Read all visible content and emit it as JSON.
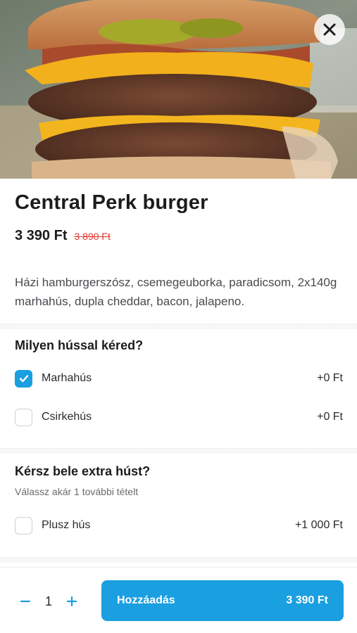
{
  "product": {
    "name": "Central Perk burger",
    "price": "3 390 Ft",
    "old_price": "3 890 Ft",
    "description": "Házi hamburgerszósz, csemegeuborka, paradicsom, 2x140g marhahús, dupla cheddar, bacon, jalapeno."
  },
  "meat_section": {
    "title": "Milyen hússal kéred?",
    "options": [
      {
        "label": "Marhahús",
        "price": "+0 Ft",
        "checked": true
      },
      {
        "label": "Csirkehús",
        "price": "+0 Ft",
        "checked": false
      }
    ]
  },
  "extra_section": {
    "title": "Kérsz bele extra húst?",
    "subtitle": "Válassz akár 1 további tételt",
    "options": [
      {
        "label": "Plusz hús",
        "price": "+1 000 Ft",
        "checked": false
      }
    ]
  },
  "footer": {
    "quantity": "1",
    "add_label": "Hozzáadás",
    "add_price": "3 390 Ft"
  },
  "colors": {
    "accent": "#1a9fe0",
    "discount": "#e53935"
  },
  "icons": {
    "close": "close-icon",
    "check": "checkmark-icon",
    "minus": "minus-icon",
    "plus": "plus-icon"
  }
}
